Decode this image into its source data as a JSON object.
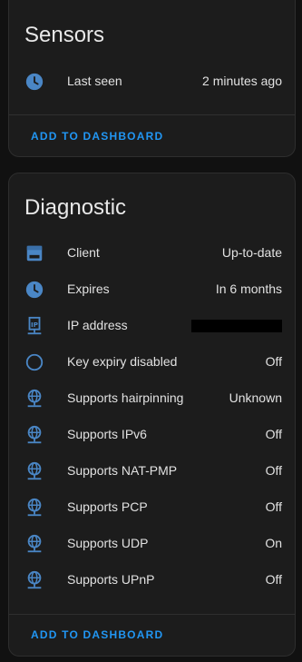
{
  "sensors": {
    "title": "Sensors",
    "rows": [
      {
        "icon": "clock-icon",
        "label": "Last seen",
        "value": "2 minutes ago"
      }
    ],
    "action_label": "ADD TO DASHBOARD"
  },
  "diagnostic": {
    "title": "Diagnostic",
    "rows": [
      {
        "icon": "client-icon",
        "label": "Client",
        "value": "Up-to-date"
      },
      {
        "icon": "clock-icon",
        "label": "Expires",
        "value": "In 6 months"
      },
      {
        "icon": "ip-network-icon",
        "label": "IP address",
        "value": ""
      },
      {
        "icon": "circle-outline-icon",
        "label": "Key expiry disabled",
        "value": "Off"
      },
      {
        "icon": "globe-network-icon",
        "label": "Supports hairpinning",
        "value": "Unknown"
      },
      {
        "icon": "globe-network-icon",
        "label": "Supports IPv6",
        "value": "Off"
      },
      {
        "icon": "globe-network-icon",
        "label": "Supports NAT-PMP",
        "value": "Off"
      },
      {
        "icon": "globe-network-icon",
        "label": "Supports PCP",
        "value": "Off"
      },
      {
        "icon": "globe-network-icon",
        "label": "Supports UDP",
        "value": "On"
      },
      {
        "icon": "globe-network-icon",
        "label": "Supports UPnP",
        "value": "Off"
      }
    ],
    "action_label": "ADD TO DASHBOARD"
  },
  "colors": {
    "background": "#111111",
    "card": "#1c1c1c",
    "icon": "#4a86c5",
    "accent": "#2196f3",
    "text": "#e1e1e1"
  }
}
